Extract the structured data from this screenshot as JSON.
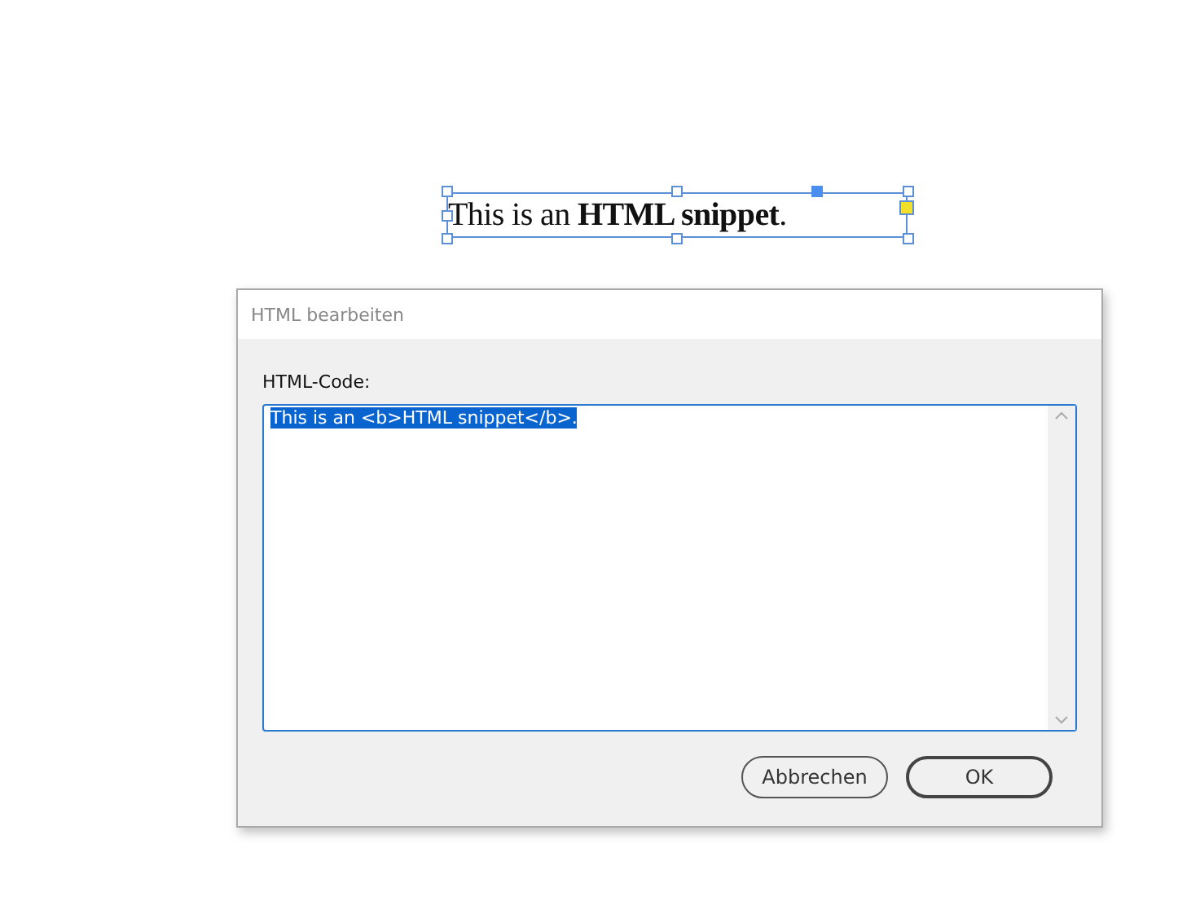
{
  "canvas": {
    "text_frame": {
      "content": "This is an **HTML snippet**.",
      "selected": true
    }
  },
  "dialog": {
    "title": "HTML bearbeiten",
    "field_label": "HTML-Code:",
    "code": {
      "value": "This is an <b>HTML snippet</b>.",
      "text_selected": true
    },
    "buttons": [
      {
        "label": "Abbrechen",
        "kind": "secondary"
      },
      {
        "label": "OK",
        "kind": "default"
      }
    ]
  }
}
